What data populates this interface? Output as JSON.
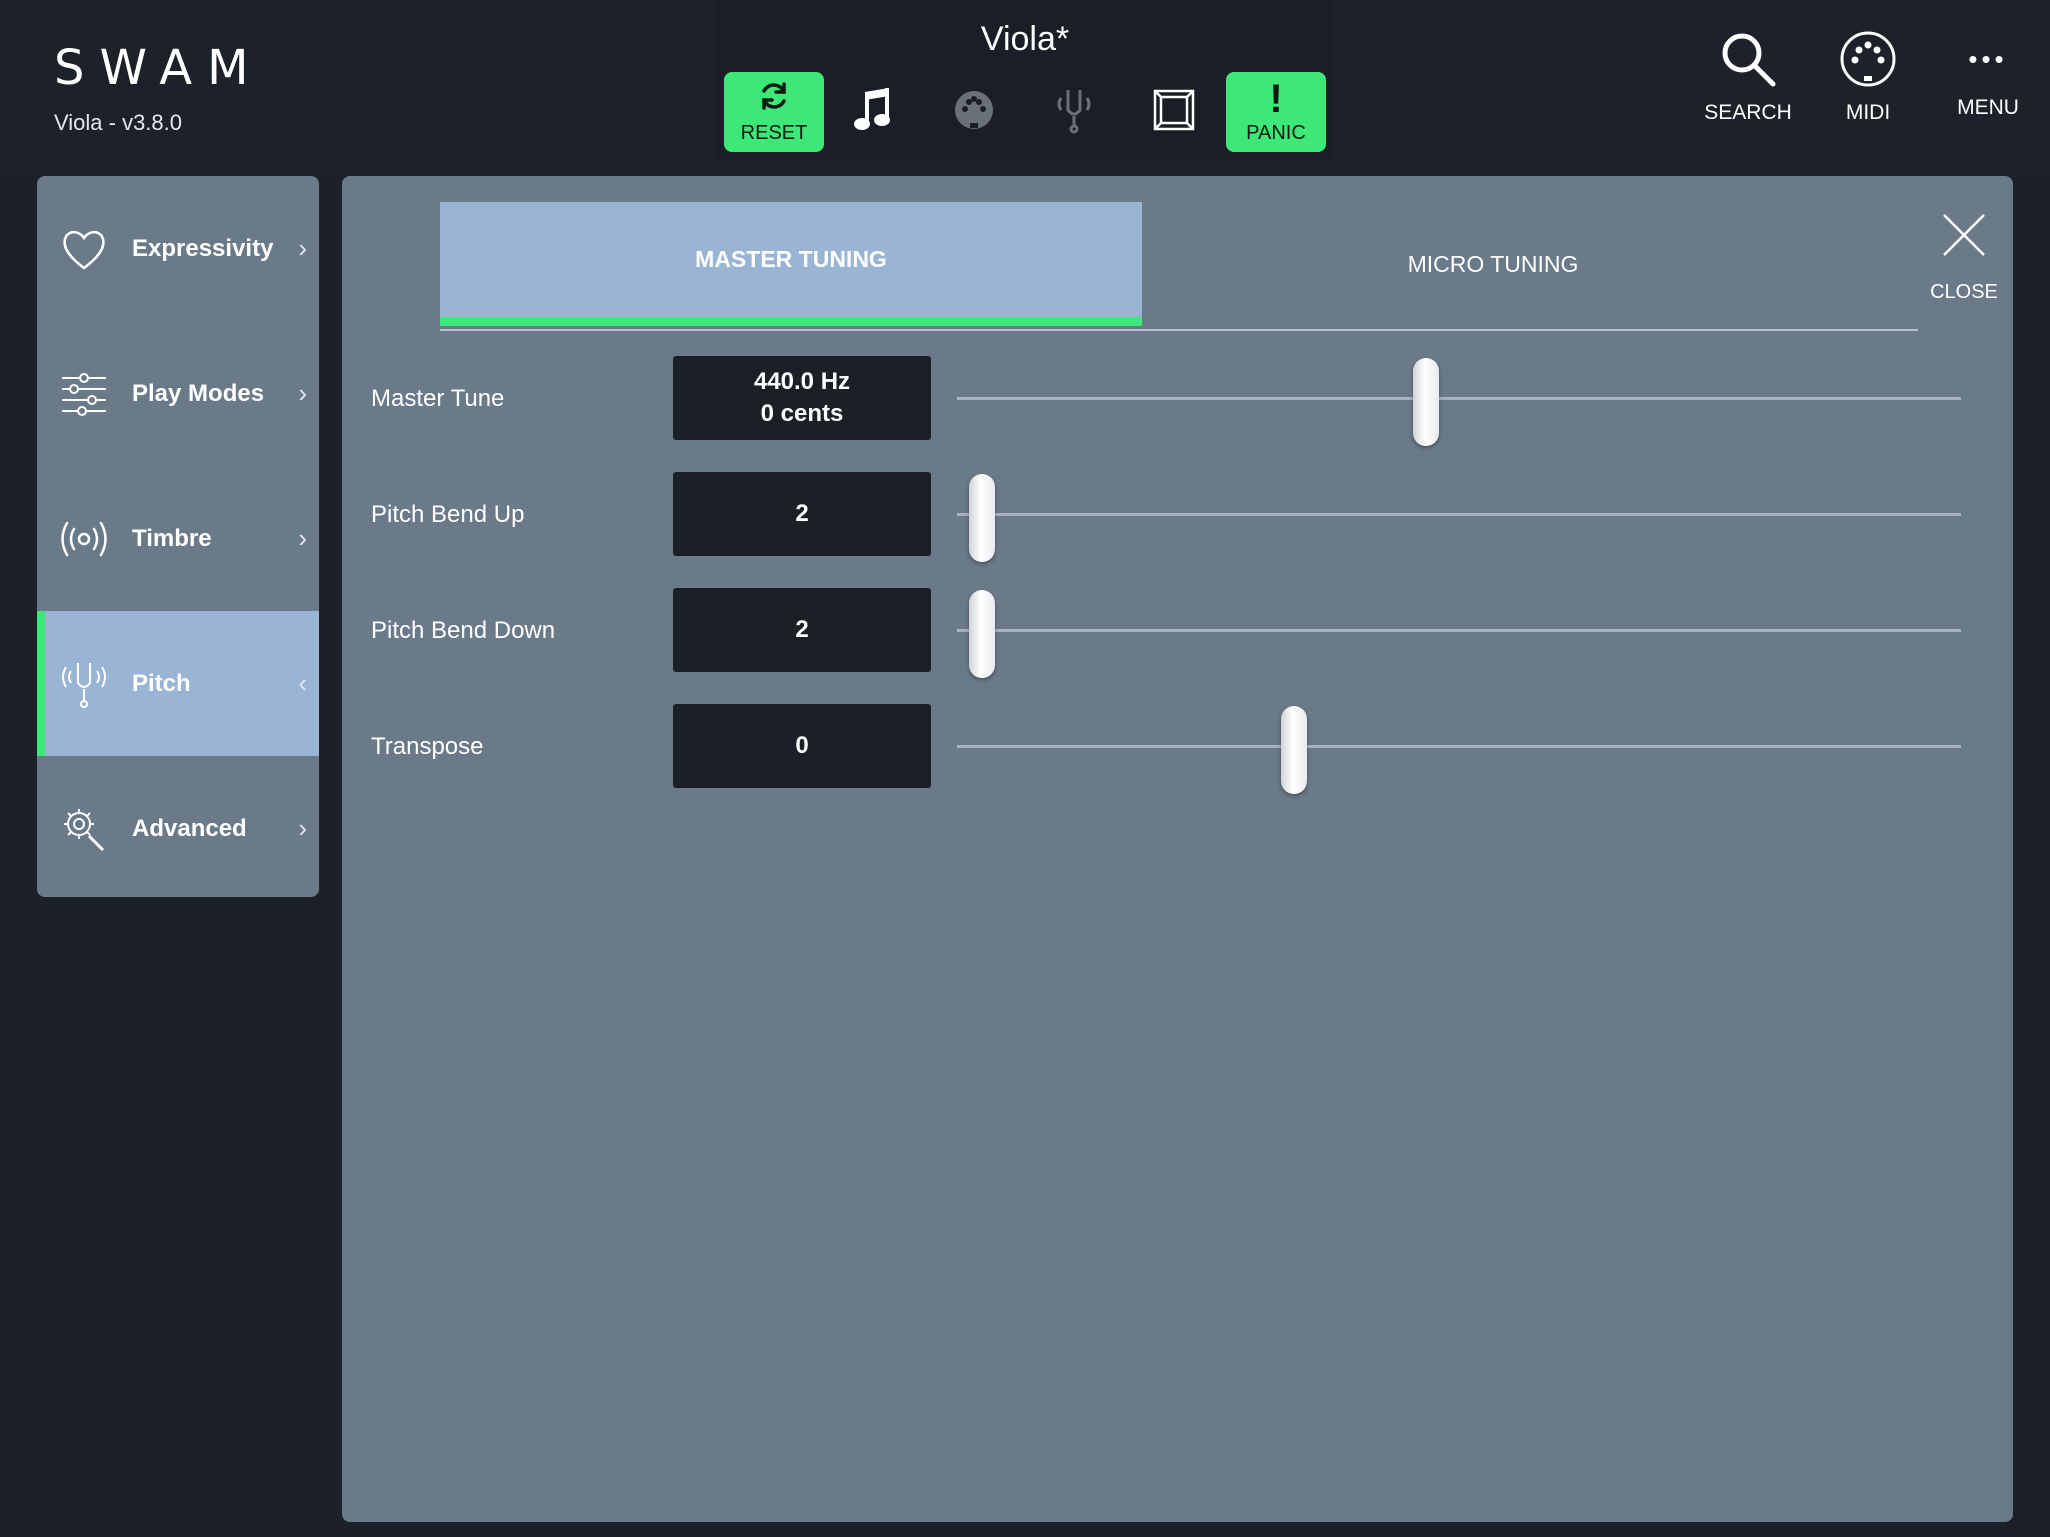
{
  "header": {
    "brand": "SWAM",
    "version": "Viola - v3.8.0",
    "preset_title": "Viola*",
    "reset_label": "RESET",
    "panic_label": "PANIC",
    "panic_symbol": "!",
    "search_label": "SEARCH",
    "midi_label": "MIDI",
    "menu_label": "MENU",
    "menu_dots": "•••"
  },
  "sidebar": {
    "items": [
      {
        "label": "Expressivity",
        "icon": "heart-icon",
        "chevron": "›"
      },
      {
        "label": "Play Modes",
        "icon": "sliders-icon",
        "chevron": "›"
      },
      {
        "label": "Timbre",
        "icon": "radio-waves-icon",
        "chevron": "›"
      },
      {
        "label": "Pitch",
        "icon": "tuning-fork-icon",
        "chevron": "‹",
        "active": true
      },
      {
        "label": "Advanced",
        "icon": "gear-search-icon",
        "chevron": "›"
      }
    ]
  },
  "tabs": {
    "master": "MASTER TUNING",
    "micro": "MICRO TUNING",
    "active": "master"
  },
  "close": {
    "label": "CLOSE"
  },
  "params": [
    {
      "label": "Master Tune",
      "value_line1": "440.0 Hz",
      "value_line2": "0 cents",
      "position": 0.47
    },
    {
      "label": "Pitch Bend Up",
      "value_line1": "2",
      "position": 0.0
    },
    {
      "label": "Pitch Bend Down",
      "value_line1": "2",
      "position": 0.0
    },
    {
      "label": "Transpose",
      "value_line1": "0",
      "position": 0.33
    }
  ],
  "colors": {
    "accent_green": "#3ee878",
    "active_blue": "#9ab4d4",
    "panel_gray": "#6b7a89",
    "background": "#1c2028"
  }
}
